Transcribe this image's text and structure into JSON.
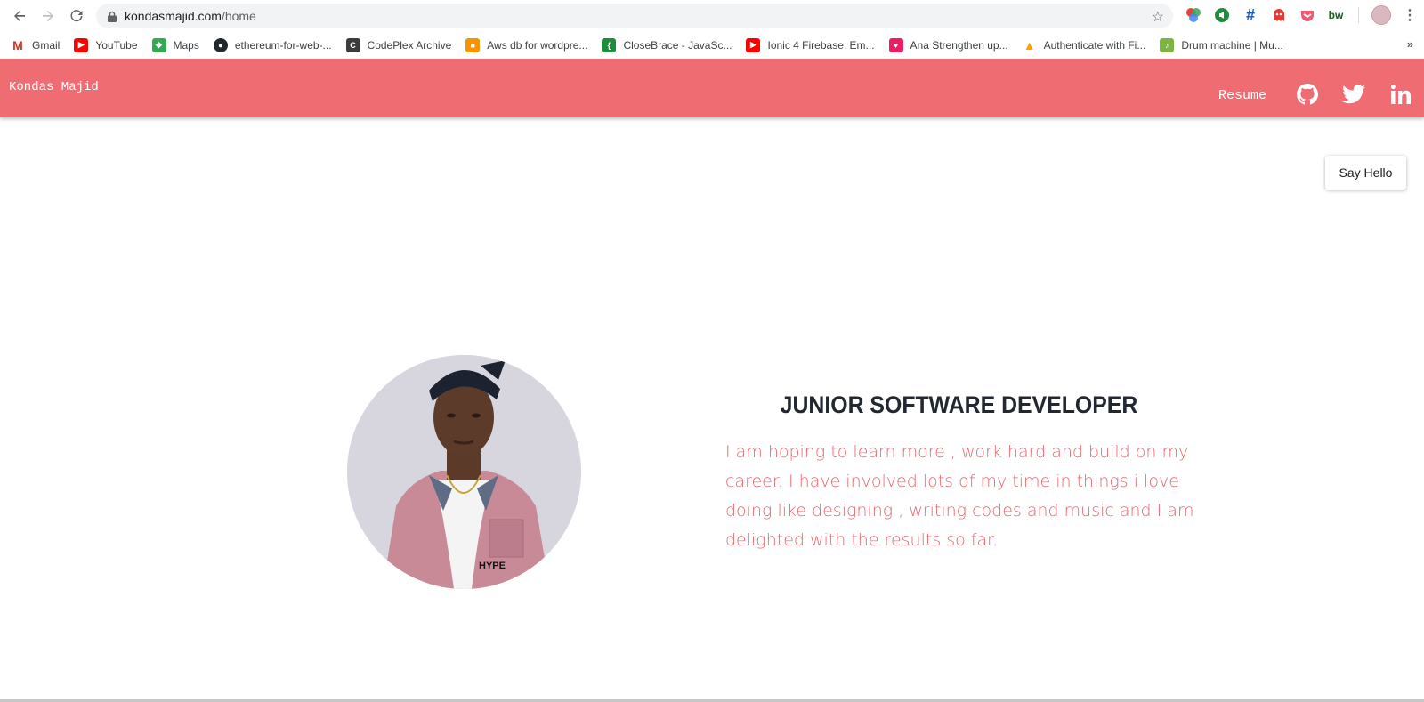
{
  "browser": {
    "url_host": "kondasmajid.com",
    "url_path": "/home",
    "bookmarks": [
      {
        "label": "Gmail",
        "color": "#d93025",
        "icon": "gmail-icon"
      },
      {
        "label": "YouTube",
        "color": "#ff0000",
        "icon": "youtube-icon"
      },
      {
        "label": "Maps",
        "color": "#34a853",
        "icon": "maps-icon"
      },
      {
        "label": "ethereum-for-web-...",
        "color": "#24292e",
        "icon": "github-icon"
      },
      {
        "label": "CodePlex Archive",
        "color": "#3c3c3c",
        "icon": "codeplex-icon"
      },
      {
        "label": "Aws db for wordpre...",
        "color": "#f79400",
        "icon": "aws-icon"
      },
      {
        "label": "CloseBrace - JavaSc...",
        "color": "#1e8e3e",
        "icon": "closebrace-icon"
      },
      {
        "label": "Ionic 4 Firebase: Em...",
        "color": "#ff0000",
        "icon": "youtube-icon"
      },
      {
        "label": "Ana Strengthen up...",
        "color": "#e91e63",
        "icon": "heart-icon"
      },
      {
        "label": "Authenticate with Fi...",
        "color": "#ffa000",
        "icon": "firebase-icon"
      },
      {
        "label": "Drum machine | Mu...",
        "color": "#7cb342",
        "icon": "music-icon"
      }
    ]
  },
  "header": {
    "brand": "Kondas Majid",
    "resume": "Resume",
    "accent_color": "#ef6c73"
  },
  "cta": {
    "say_hello": "Say Hello"
  },
  "hero": {
    "title": "JUNIOR SOFTWARE DEVELOPER",
    "bio": "I am hoping to learn more , work hard and build on my career. I have involved lots of my time in things i love doing like designing , writing codes and music and I am delighted with the results so far."
  }
}
